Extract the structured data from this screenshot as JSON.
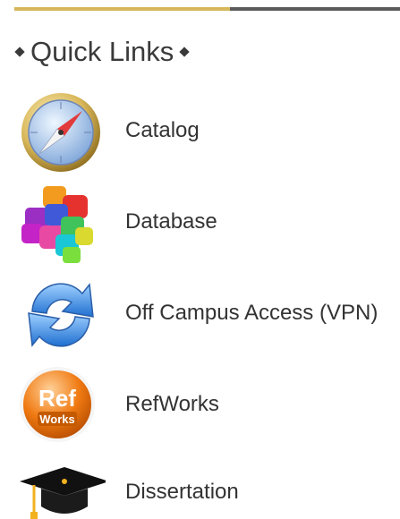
{
  "panel": {
    "title": "Quick Links",
    "accent_gold": "#d7b75a",
    "accent_dark": "#5b5b5b"
  },
  "links": [
    {
      "label": "Catalog",
      "icon": "compass-icon"
    },
    {
      "label": "Database",
      "icon": "colored-cubes-icon"
    },
    {
      "label": "Off Campus Access (VPN)",
      "icon": "refresh-arrows-icon"
    },
    {
      "label": "RefWorks",
      "icon": "refworks-badge-icon",
      "badge_top": "Ref",
      "badge_bottom": "Works"
    },
    {
      "label": "Dissertation",
      "icon": "graduation-cap-icon"
    }
  ]
}
